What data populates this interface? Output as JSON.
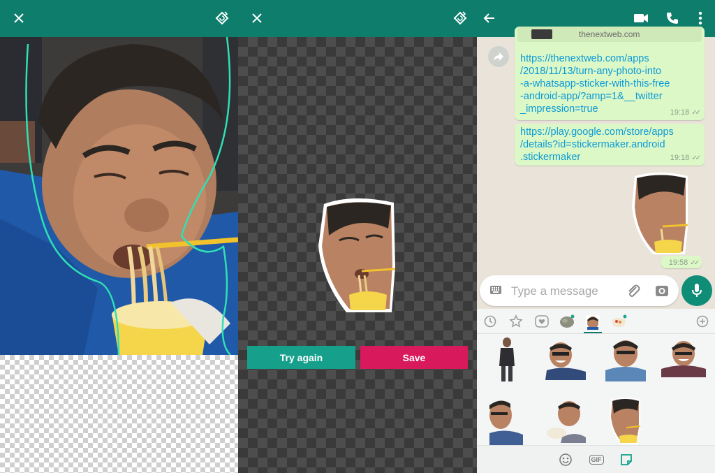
{
  "editor": {
    "close_icon": "close-icon",
    "rotate_icon": "rotate-icon"
  },
  "preview": {
    "try_again_label": "Try again",
    "save_label": "Save"
  },
  "chat": {
    "header": {
      "back_icon": "arrow-back-icon",
      "video_icon": "video-call-icon",
      "call_icon": "phone-icon",
      "menu_icon": "more-vert-icon"
    },
    "preview_domain": "thenextweb.com",
    "messages": [
      {
        "lines": [
          "https://thenextweb.com/apps",
          "/2018/11/13/turn-any-photo-into",
          "-a-whatsapp-sticker-with-this-free",
          "-android-app/?amp=1&__twitter",
          "_impression=true"
        ],
        "time": "19:18"
      },
      {
        "lines": [
          "https://play.google.com/store/apps",
          "/details?id=stickermaker.android",
          ".stickermaker"
        ],
        "time": "19:18"
      },
      {
        "sticker": true,
        "time": "19:58"
      }
    ],
    "composer": {
      "placeholder": "Type a message"
    },
    "tray": {
      "bottom_gif": "GIF"
    }
  },
  "colors": {
    "appbar": "#0e7d6c",
    "try_again": "#16a08b",
    "save": "#d8195c",
    "bubble": "#dcf8c6",
    "link": "#0b9ad8"
  }
}
